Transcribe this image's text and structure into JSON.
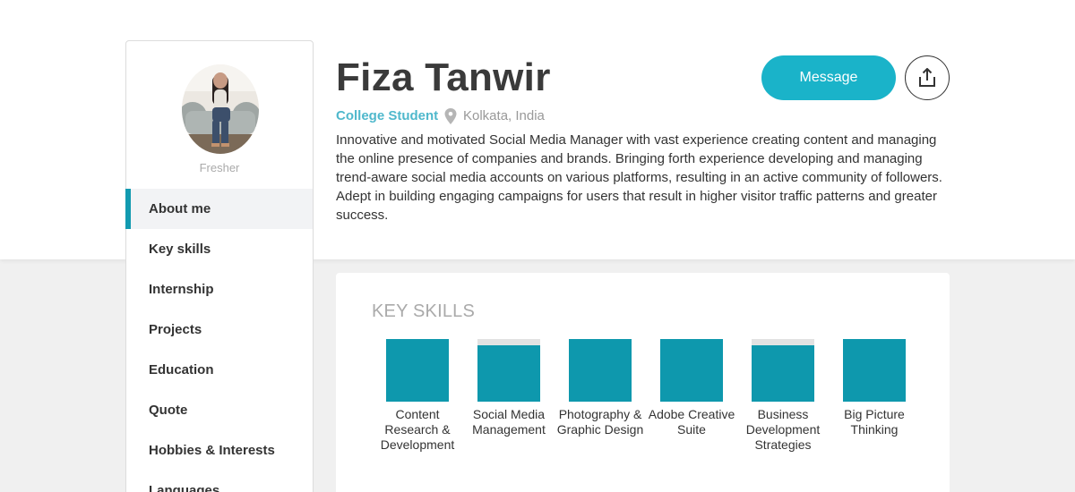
{
  "profile": {
    "name": "Fiza Tanwir",
    "role": "College Student",
    "location": "Kolkata, India",
    "status": "Fresher",
    "bio": "Innovative and motivated Social Media Manager with vast experience creating content and managing the online presence of companies and brands. Bringing forth experience developing and managing trend-aware social media accounts on various platforms, resulting in an active community of followers. Adept in building engaging campaigns for users that result in higher visitor traffic patterns and greater success."
  },
  "actions": {
    "message_label": "Message",
    "share_icon": "share-upload-icon"
  },
  "sidebar": {
    "items": [
      {
        "label": "About me",
        "active": true
      },
      {
        "label": "Key skills"
      },
      {
        "label": "Internship"
      },
      {
        "label": "Projects"
      },
      {
        "label": "Education"
      },
      {
        "label": "Quote"
      },
      {
        "label": "Hobbies & Interests"
      },
      {
        "label": "Languages"
      }
    ]
  },
  "key_skills": {
    "title": "KEY SKILLS",
    "items": [
      {
        "label": "Content Research & Development"
      },
      {
        "label": "Social Media Management"
      },
      {
        "label": "Photography & Graphic Design"
      },
      {
        "label": "Adobe Creative Suite"
      },
      {
        "label": "Business Development Strategies"
      },
      {
        "label": "Big Picture Thinking"
      }
    ]
  },
  "colors": {
    "accent": "#1ab3c9",
    "tile": "#0e98ad",
    "role_text": "#4fb8cc"
  }
}
